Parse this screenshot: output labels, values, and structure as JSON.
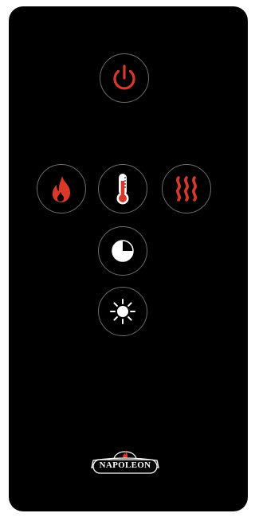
{
  "remote": {
    "buttons": [
      {
        "id": "power",
        "icon": "power-icon"
      },
      {
        "id": "flame",
        "icon": "flame-icon"
      },
      {
        "id": "thermo",
        "icon": "thermometer-icon"
      },
      {
        "id": "heat",
        "icon": "heat-waves-icon"
      },
      {
        "id": "timer",
        "icon": "timer-icon"
      },
      {
        "id": "bright",
        "icon": "brightness-icon"
      }
    ],
    "brand": {
      "label": "NAPOLEON"
    }
  },
  "colors": {
    "background": "#000000",
    "accent_red": "#d9392b",
    "icon_white": "#ffffff",
    "button_border": "#6d6d6d"
  }
}
